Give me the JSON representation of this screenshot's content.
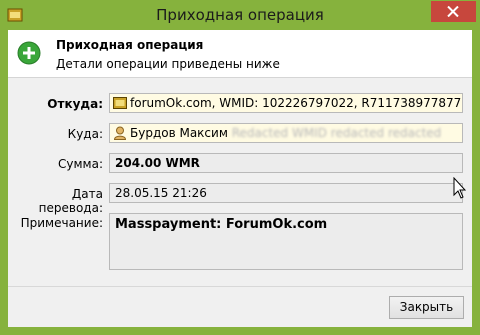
{
  "window": {
    "title": "Приходная операция",
    "accent_color": "#86b23d",
    "close_color": "#c7473d"
  },
  "header": {
    "title": "Приходная операция",
    "subtitle": "Детали операции приведены ниже",
    "icon": "plus-circle-icon"
  },
  "fields": {
    "from": {
      "label": "Откуда:",
      "value": "forumOk.com, WMID: 102226797022, R711738977877",
      "icon": "wallet-icon"
    },
    "to": {
      "label": "Куда:",
      "value": "Бурдов Максим",
      "value_redacted": "Redacted WMID redacted redacted",
      "icon": "user-icon"
    },
    "amount": {
      "label": "Сумма:",
      "value": "204.00 WMR"
    },
    "date": {
      "label": "Дата перевода:",
      "value": "28.05.15 21:26"
    },
    "note": {
      "label": "Примечание:",
      "value": "Masspayment: ForumOk.com"
    }
  },
  "footer": {
    "close_label": "Закрыть"
  }
}
